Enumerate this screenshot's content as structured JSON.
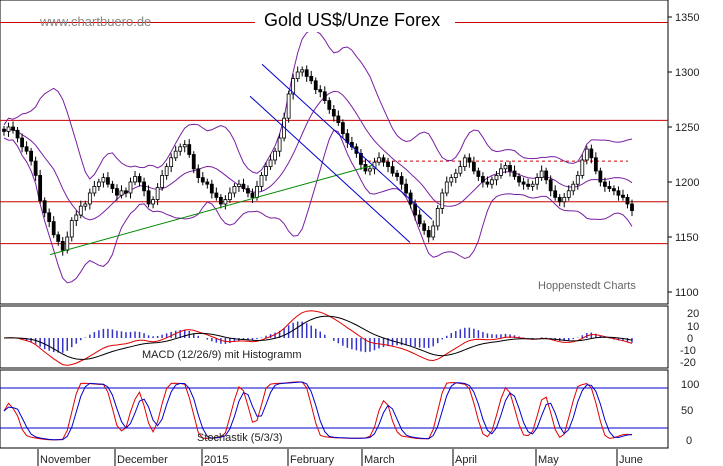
{
  "chart_data": {
    "type": "candlestick",
    "title": "Gold US$/Unze Forex",
    "watermark": "www.chartbuero.de",
    "source_label": "Hoppenstedt Charts",
    "colors": {
      "candle": "#000000",
      "bollinger": "#7a1fa2",
      "horizontal_lines": "#cc0000",
      "trend_channel": "#0000cc",
      "support_trend": "#008800",
      "osc_red": "#e00000",
      "osc_blue": "#0000cc",
      "histogram": "#3333cc"
    },
    "price_axis": {
      "ticks": [
        1100,
        1150,
        1200,
        1250,
        1300,
        1350
      ],
      "ylim": [
        1100,
        1360
      ]
    },
    "macd_axis": {
      "ticks": [
        20,
        10,
        0,
        -10,
        -20
      ]
    },
    "stoch_axis": {
      "ticks": [
        100,
        50,
        0
      ]
    },
    "x_labels": [
      "November",
      "December",
      "2015",
      "February",
      "March",
      "April",
      "May",
      "June"
    ],
    "horizontal_lines": [
      1345,
      1256,
      1182,
      1144
    ],
    "dashed_line": 1219,
    "price_series": [
      1246,
      1250,
      1247,
      1240,
      1232,
      1228,
      1219,
      1206,
      1183,
      1172,
      1164,
      1152,
      1146,
      1138,
      1150,
      1165,
      1170,
      1178,
      1180,
      1190,
      1196,
      1200,
      1204,
      1198,
      1194,
      1188,
      1192,
      1190,
      1200,
      1205,
      1200,
      1192,
      1180,
      1184,
      1195,
      1206,
      1214,
      1222,
      1228,
      1232,
      1234,
      1225,
      1212,
      1204,
      1200,
      1198,
      1190,
      1186,
      1180,
      1184,
      1190,
      1196,
      1198,
      1194,
      1190,
      1186,
      1196,
      1206,
      1214,
      1220,
      1228,
      1240,
      1258,
      1280,
      1294,
      1300,
      1302,
      1296,
      1292,
      1284,
      1282,
      1274,
      1266,
      1260,
      1254,
      1244,
      1236,
      1232,
      1226,
      1216,
      1210,
      1212,
      1218,
      1222,
      1218,
      1214,
      1208,
      1205,
      1198,
      1190,
      1180,
      1170,
      1162,
      1156,
      1150,
      1160,
      1176,
      1190,
      1200,
      1204,
      1208,
      1214,
      1222,
      1218,
      1210,
      1205,
      1200,
      1198,
      1202,
      1206,
      1212,
      1215,
      1210,
      1205,
      1200,
      1198,
      1196,
      1198,
      1204,
      1210,
      1202,
      1192,
      1186,
      1182,
      1186,
      1192,
      1198,
      1206,
      1220,
      1230,
      1222,
      1210,
      1200,
      1196,
      1194,
      1192,
      1188,
      1186,
      1180,
      1174
    ],
    "macd": {
      "label": "MACD (12/26/9) mit Histogramm"
    },
    "stochastic": {
      "label": "Stochastik (5/3/3)"
    }
  }
}
